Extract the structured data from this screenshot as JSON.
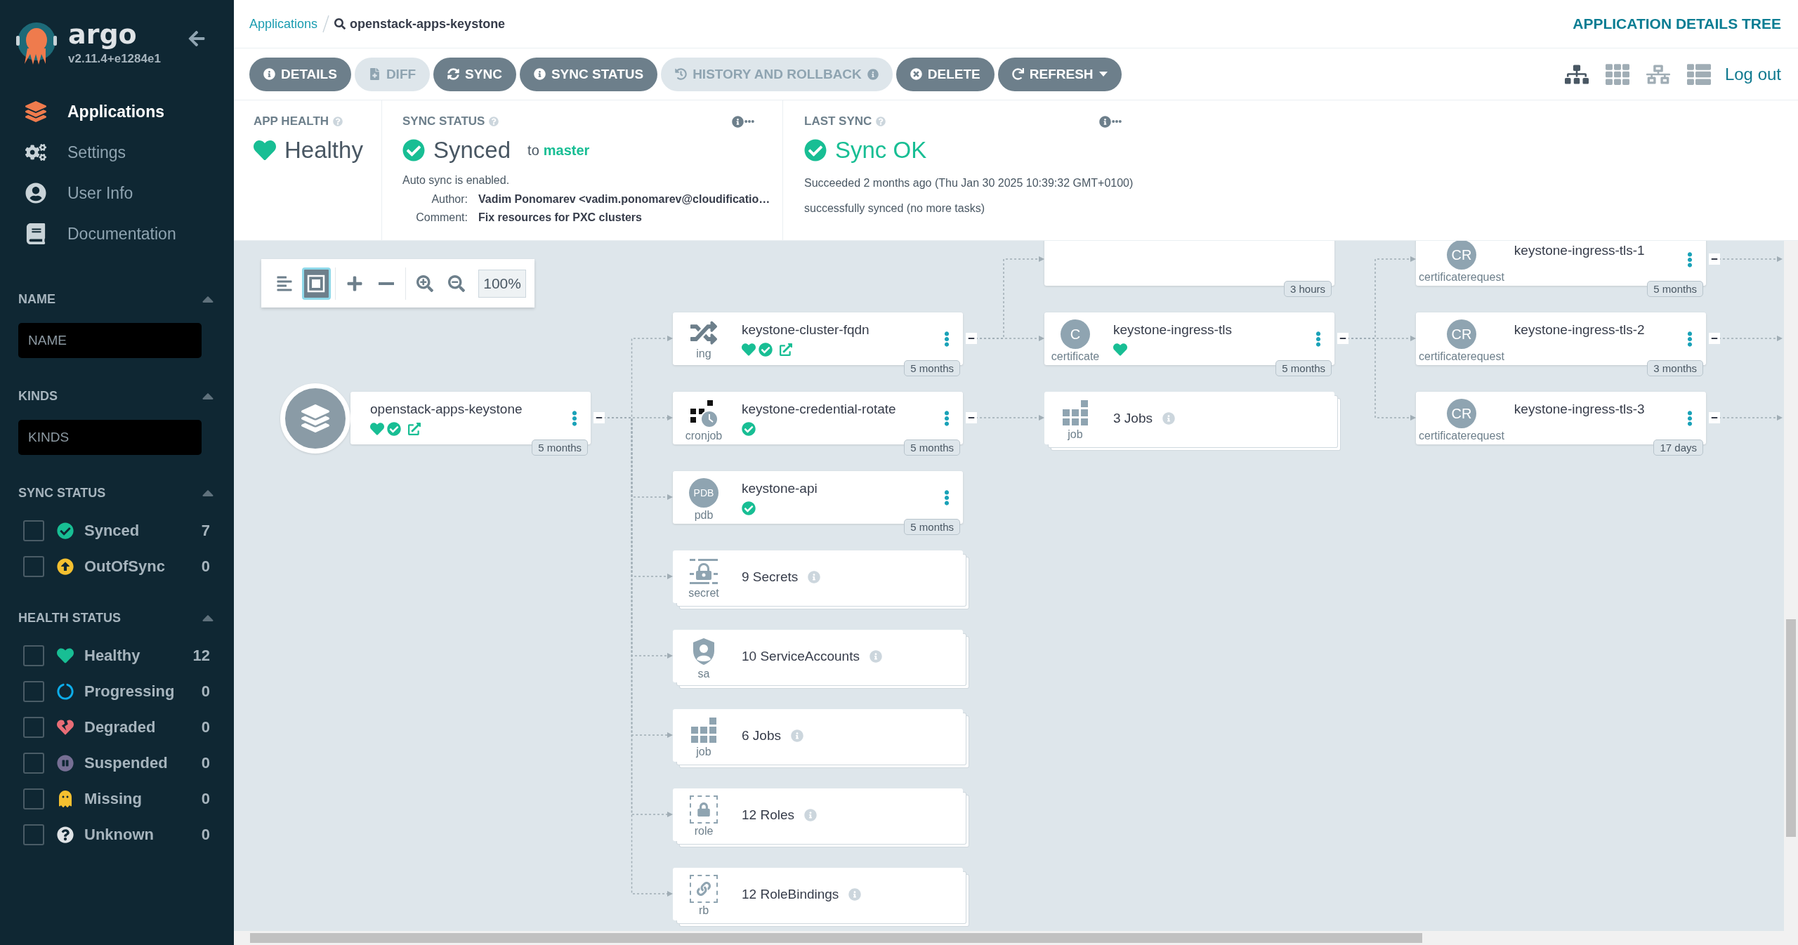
{
  "sidebar": {
    "brand": "argo",
    "version": "v2.11.4+e1284e1",
    "nav": [
      {
        "kind": "applications",
        "label": "Applications",
        "selected": true
      },
      {
        "kind": "settings",
        "label": "Settings",
        "selected": false
      },
      {
        "kind": "user",
        "label": "User Info",
        "selected": false
      },
      {
        "kind": "docs",
        "label": "Documentation",
        "selected": false
      }
    ],
    "filters": [
      {
        "kind": "input",
        "title": "NAME",
        "expanded": true,
        "placeholder": "NAME"
      },
      {
        "kind": "input",
        "title": "KINDS",
        "expanded": true,
        "placeholder": "KINDS"
      },
      {
        "kind": "checklist",
        "title": "SYNC STATUS",
        "expanded": true,
        "items": [
          {
            "kind": "synced",
            "label": "Synced",
            "count": "7",
            "checked": false
          },
          {
            "kind": "outofsync",
            "label": "OutOfSync",
            "count": "0",
            "checked": false
          }
        ]
      },
      {
        "kind": "checklist",
        "title": "HEALTH STATUS",
        "expanded": true,
        "items": [
          {
            "kind": "healthy",
            "label": "Healthy",
            "count": "12",
            "checked": false
          },
          {
            "kind": "progressing",
            "label": "Progressing",
            "count": "0",
            "checked": false
          },
          {
            "kind": "degraded",
            "label": "Degraded",
            "count": "0",
            "checked": false
          },
          {
            "kind": "suspended",
            "label": "Suspended",
            "count": "0",
            "checked": false
          },
          {
            "kind": "missing",
            "label": "Missing",
            "count": "0",
            "checked": false
          },
          {
            "kind": "unknown",
            "label": "Unknown",
            "count": "0",
            "checked": false
          }
        ]
      }
    ]
  },
  "breadcrumb": {
    "parent": "Applications",
    "current": "openstack-apps-keystone"
  },
  "page_title": "APPLICATION DETAILS TREE",
  "actions": [
    {
      "kind": "details",
      "label": "DETAILS",
      "disabled": false
    },
    {
      "kind": "diff",
      "label": "DIFF",
      "disabled": true
    },
    {
      "kind": "sync",
      "label": "SYNC",
      "disabled": false
    },
    {
      "kind": "sync-status",
      "label": "SYNC STATUS",
      "disabled": false
    },
    {
      "kind": "history",
      "label": "HISTORY AND ROLLBACK",
      "disabled": true
    },
    {
      "kind": "delete",
      "label": "DELETE",
      "disabled": false
    },
    {
      "kind": "refresh",
      "label": "REFRESH",
      "disabled": false
    }
  ],
  "views": [
    {
      "kind": "tree",
      "selected": true
    },
    {
      "kind": "pods",
      "selected": false
    },
    {
      "kind": "network",
      "selected": false
    },
    {
      "kind": "list",
      "selected": false
    }
  ],
  "logout": "Log out",
  "status": {
    "app_health": {
      "title": "APP HEALTH",
      "kind": "healthy",
      "status": "Healthy"
    },
    "sync_status": {
      "title": "SYNC STATUS",
      "kind": "synced",
      "status": "Synced",
      "to_label": "to",
      "target": "master",
      "auto_sync": "Auto sync is enabled.",
      "author_label": "Author:",
      "author": "Vadim Ponomarev <vadim.ponomarev@cloudificatio…",
      "comment_label": "Comment:",
      "comment": "Fix resources for PXC clusters"
    },
    "last_sync": {
      "title": "LAST SYNC",
      "kind": "succeeded",
      "status": "Sync OK",
      "time": "Succeeded 2 months ago (Thu Jan 30 2025 10:39:32 GMT+0100)",
      "message": "successfully synced (no more tasks)"
    }
  },
  "graph_tools": {
    "buttons": [
      {
        "kind": "align",
        "selected": false
      },
      {
        "kind": "fit",
        "selected": true
      },
      {
        "kind": "expand",
        "selected": false
      },
      {
        "kind": "collapse",
        "selected": false
      },
      {
        "kind": "zoom-in",
        "selected": false
      },
      {
        "kind": "zoom-out",
        "selected": false
      }
    ],
    "zoom": "100%"
  },
  "tree": {
    "kind": "application",
    "name": "openstack-apps-keystone",
    "healthy": true,
    "synced": true,
    "link": true,
    "menu": true,
    "expanded": true,
    "age": "5 months",
    "children": [
      {
        "kind": "ingress",
        "type_label": "ing",
        "name": "keystone-cluster-fqdn",
        "healthy": true,
        "synced": true,
        "link": true,
        "menu": true,
        "expanded": true,
        "age": "5 months",
        "children": [
          {
            "kind": "resource",
            "age": "3 hours"
          },
          {
            "kind": "certificate",
            "icon_text": "C",
            "type_label": "certificate",
            "name": "keystone-ingress-tls",
            "healthy": true,
            "menu": true,
            "expanded": true,
            "age": "5 months",
            "children": [
              {
                "kind": "certificaterequest",
                "icon_text": "CR",
                "type_label": "certificaterequest",
                "name": "keystone-ingress-tls-1",
                "menu": true,
                "expanded": true,
                "age": "5 months"
              },
              {
                "kind": "certificaterequest",
                "icon_text": "CR",
                "type_label": "certificaterequest",
                "name": "keystone-ingress-tls-2",
                "menu": true,
                "expanded": true,
                "age": "3 months"
              },
              {
                "kind": "certificaterequest",
                "icon_text": "CR",
                "type_label": "certificaterequest",
                "name": "keystone-ingress-tls-3",
                "menu": true,
                "expanded": true,
                "age": "17 days"
              }
            ]
          }
        ]
      },
      {
        "kind": "cronjob",
        "type_label": "cronjob",
        "name": "keystone-credential-rotate",
        "synced": true,
        "menu": true,
        "expanded": true,
        "age": "5 months",
        "children": [
          {
            "kind": "job",
            "type_label": "job",
            "group": true,
            "name": "3 Jobs"
          }
        ]
      },
      {
        "kind": "pdb",
        "icon_text": "PDB",
        "type_label": "pdb",
        "name": "keystone-api",
        "synced": true,
        "menu": true,
        "age": "5 months"
      },
      {
        "kind": "secret",
        "type_label": "secret",
        "group": true,
        "name": "9 Secrets"
      },
      {
        "kind": "serviceaccount",
        "type_label": "sa",
        "group": true,
        "name": "10 ServiceAccounts"
      },
      {
        "kind": "job",
        "type_label": "job",
        "group": true,
        "name": "6 Jobs"
      },
      {
        "kind": "role",
        "type_label": "role",
        "group": true,
        "name": "12 Roles"
      },
      {
        "kind": "rolebinding",
        "type_label": "rb",
        "group": true,
        "name": "12 RoleBindings"
      }
    ]
  }
}
